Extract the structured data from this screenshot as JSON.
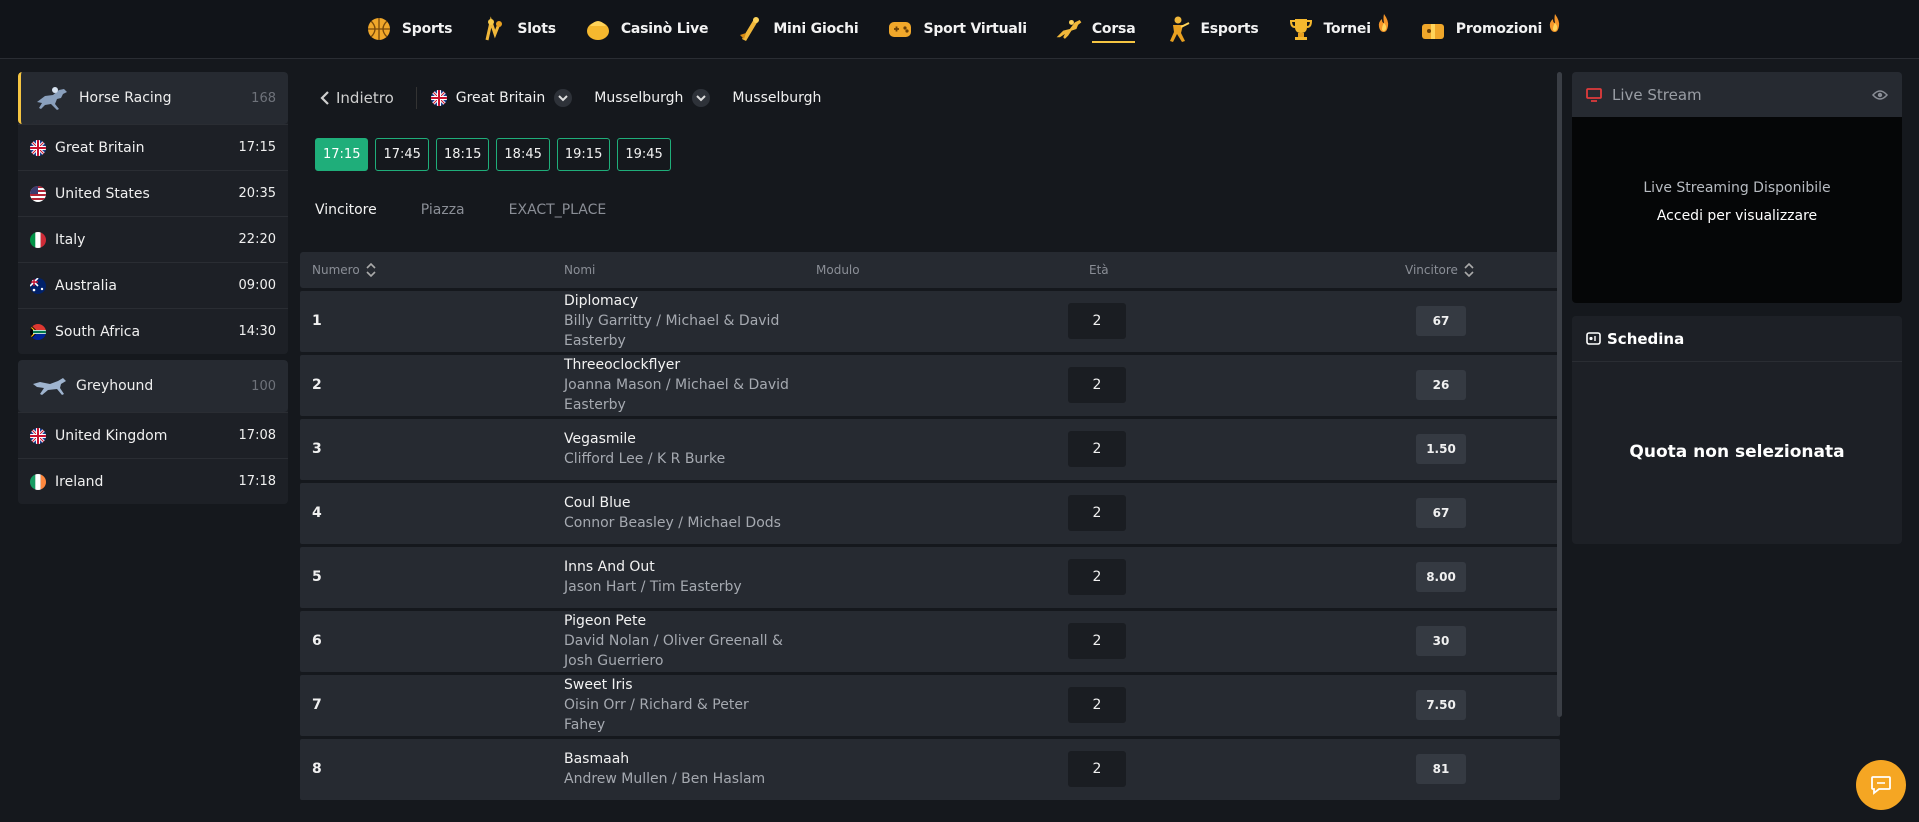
{
  "topnav": {
    "items": [
      {
        "label": "Sports",
        "icon": "basketball-icon",
        "active": false,
        "hot": false
      },
      {
        "label": "Slots",
        "icon": "slot-machine-icon",
        "active": false,
        "hot": false
      },
      {
        "label": "Casinò Live",
        "icon": "poker-chip-icon",
        "active": false,
        "hot": false
      },
      {
        "label": "Mini Giochi",
        "icon": "rocket-icon",
        "active": false,
        "hot": false
      },
      {
        "label": "Sport Virtuali",
        "icon": "gamepad-icon",
        "active": false,
        "hot": false
      },
      {
        "label": "Corsa",
        "icon": "horse-jump-icon",
        "active": true,
        "hot": false
      },
      {
        "label": "Esports",
        "icon": "soldier-icon",
        "active": false,
        "hot": false
      },
      {
        "label": "Tornei",
        "icon": "trophy-icon",
        "active": false,
        "hot": true
      },
      {
        "label": "Promozioni",
        "icon": "gift-icon",
        "active": false,
        "hot": true
      }
    ]
  },
  "sidebar": {
    "horse_racing": {
      "label": "Horse Racing",
      "count": "168",
      "countries": [
        {
          "name": "Great Britain",
          "time": "17:15",
          "flag": "gb"
        },
        {
          "name": "United States",
          "time": "20:35",
          "flag": "us"
        },
        {
          "name": "Italy",
          "time": "22:20",
          "flag": "it"
        },
        {
          "name": "Australia",
          "time": "09:00",
          "flag": "au"
        },
        {
          "name": "South Africa",
          "time": "14:30",
          "flag": "za"
        }
      ]
    },
    "greyhound": {
      "label": "Greyhound",
      "count": "100",
      "countries": [
        {
          "name": "United Kingdom",
          "time": "17:08",
          "flag": "gb"
        },
        {
          "name": "Ireland",
          "time": "17:18",
          "flag": "ie"
        }
      ]
    }
  },
  "breadcrumb": {
    "back": "Indietro",
    "country": "Great Britain",
    "track": "Musselburgh",
    "current": "Musselburgh"
  },
  "race_times": [
    "17:15",
    "17:45",
    "18:15",
    "18:45",
    "19:15",
    "19:45"
  ],
  "selected_time": "17:15",
  "market_tabs": [
    "Vincitore",
    "Piazza",
    "EXACT_PLACE"
  ],
  "table": {
    "headers": {
      "number": "Numero",
      "names": "Nomi",
      "form": "Modulo",
      "age": "Età",
      "winner": "Vincitore"
    },
    "rows": [
      {
        "num": "1",
        "horse": "Diplomacy",
        "jockey": "Billy Garritty / Michael & David Easterby",
        "age": "2",
        "odd": "67"
      },
      {
        "num": "2",
        "horse": "Threeoclockflyer",
        "jockey": "Joanna Mason / Michael & David Easterby",
        "age": "2",
        "odd": "26"
      },
      {
        "num": "3",
        "horse": "Vegasmile",
        "jockey": "Clifford Lee / K R Burke",
        "age": "2",
        "odd": "1.50"
      },
      {
        "num": "4",
        "horse": "Coul Blue",
        "jockey": "Connor Beasley / Michael Dods",
        "age": "2",
        "odd": "67"
      },
      {
        "num": "5",
        "horse": "Inns And Out",
        "jockey": "Jason Hart / Tim Easterby",
        "age": "2",
        "odd": "8.00"
      },
      {
        "num": "6",
        "horse": "Pigeon Pete",
        "jockey": "David Nolan / Oliver Greenall & Josh Guerriero",
        "age": "2",
        "odd": "30"
      },
      {
        "num": "7",
        "horse": "Sweet Iris",
        "jockey": "Oisin Orr / Richard & Peter Fahey",
        "age": "2",
        "odd": "7.50"
      },
      {
        "num": "8",
        "horse": "Basmaah",
        "jockey": "Andrew Mullen / Ben Haslam",
        "age": "2",
        "odd": "81"
      }
    ]
  },
  "live_stream": {
    "title": "Live Stream",
    "line1": "Live Streaming Disponibile",
    "line2": "Accedi per visualizzare"
  },
  "betslip": {
    "title": "Schedina",
    "empty": "Quota non selezionata"
  },
  "colors": {
    "accent": "#f5c542",
    "green": "#1fae7a",
    "chat": "#f5a623"
  }
}
